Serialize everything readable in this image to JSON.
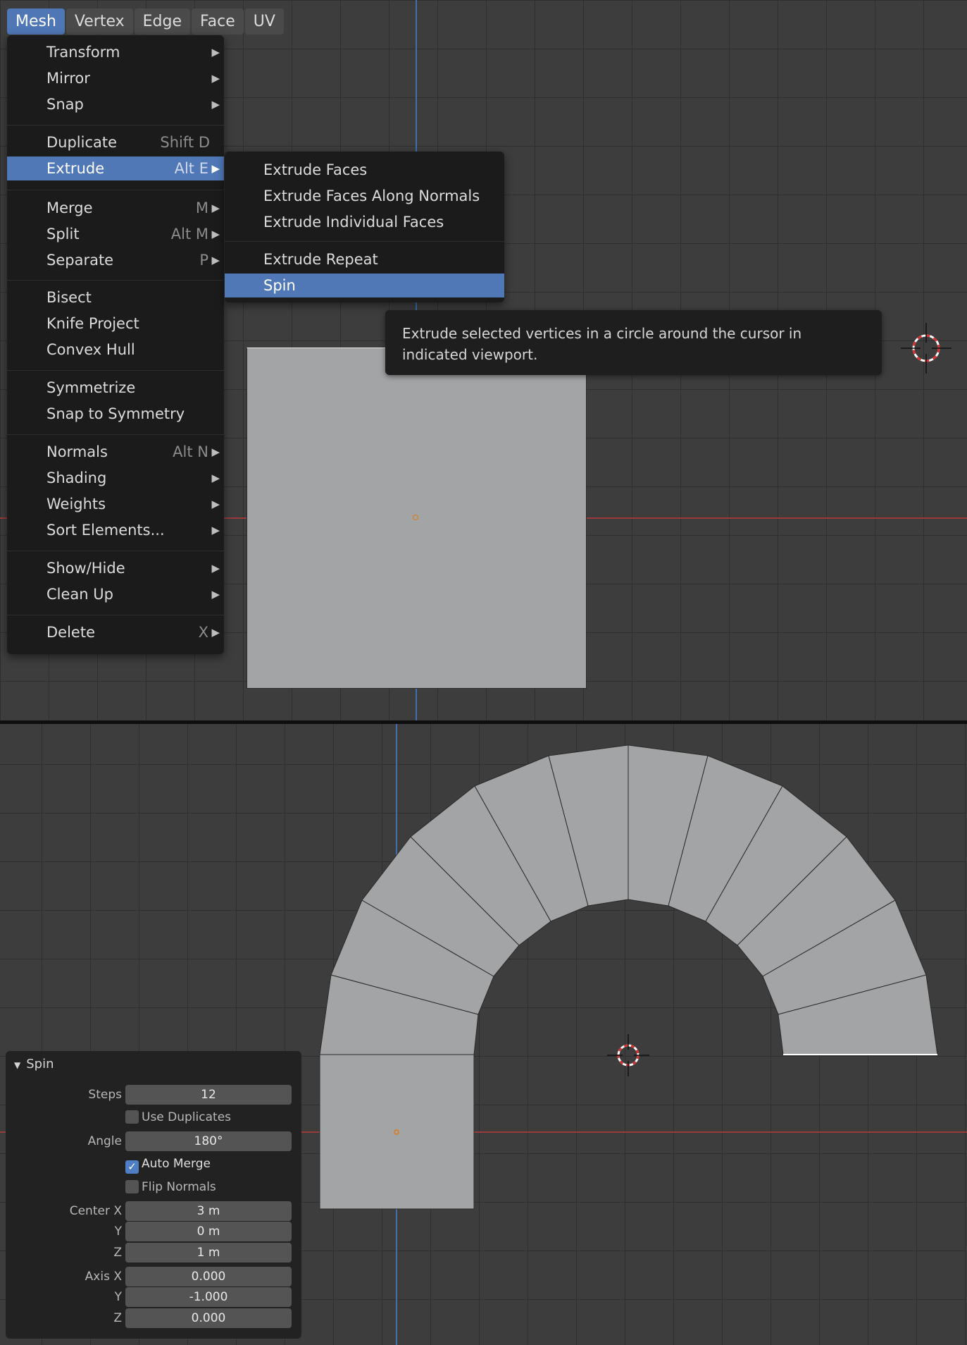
{
  "header_menus": [
    {
      "label": "Mesh",
      "active": true
    },
    {
      "label": "Vertex",
      "active": false
    },
    {
      "label": "Edge",
      "active": false
    },
    {
      "label": "Face",
      "active": false
    },
    {
      "label": "UV",
      "active": false
    }
  ],
  "mesh_menu": {
    "items": [
      {
        "label": "Transform",
        "shortcut": "",
        "submenu": true
      },
      {
        "label": "Mirror",
        "shortcut": "",
        "submenu": true
      },
      {
        "label": "Snap",
        "shortcut": "",
        "submenu": true
      },
      {
        "label": "Duplicate",
        "shortcut": "Shift D",
        "submenu": false
      },
      {
        "label": "Extrude",
        "shortcut": "Alt E",
        "submenu": true,
        "highlighted": true
      },
      {
        "label": "Merge",
        "shortcut": "M",
        "submenu": true
      },
      {
        "label": "Split",
        "shortcut": "Alt M",
        "submenu": true
      },
      {
        "label": "Separate",
        "shortcut": "P",
        "submenu": true
      },
      {
        "label": "Bisect",
        "shortcut": "",
        "submenu": false
      },
      {
        "label": "Knife Project",
        "shortcut": "",
        "submenu": false
      },
      {
        "label": "Convex Hull",
        "shortcut": "",
        "submenu": false
      },
      {
        "label": "Symmetrize",
        "shortcut": "",
        "submenu": false
      },
      {
        "label": "Snap to Symmetry",
        "shortcut": "",
        "submenu": false
      },
      {
        "label": "Normals",
        "shortcut": "Alt N",
        "submenu": true
      },
      {
        "label": "Shading",
        "shortcut": "",
        "submenu": true
      },
      {
        "label": "Weights",
        "shortcut": "",
        "submenu": true
      },
      {
        "label": "Sort Elements...",
        "shortcut": "",
        "submenu": true
      },
      {
        "label": "Show/Hide",
        "shortcut": "",
        "submenu": true
      },
      {
        "label": "Clean Up",
        "shortcut": "",
        "submenu": true
      },
      {
        "label": "Delete",
        "shortcut": "X",
        "submenu": true
      }
    ]
  },
  "extrude_menu": {
    "items": [
      {
        "label": "Extrude Faces"
      },
      {
        "label": "Extrude Faces Along Normals"
      },
      {
        "label": "Extrude Individual Faces"
      },
      {
        "label": "Extrude Repeat"
      },
      {
        "label": "Spin",
        "highlighted": true
      }
    ]
  },
  "tooltip": {
    "text": "Extrude selected vertices in a circle around the cursor in indicated viewport."
  },
  "spin_panel": {
    "title": "Spin",
    "steps_label": "Steps",
    "steps": "12",
    "use_duplicates_label": "Use Duplicates",
    "use_duplicates": false,
    "angle_label": "Angle",
    "angle": "180°",
    "auto_merge_label": "Auto Merge",
    "auto_merge": true,
    "flip_normals_label": "Flip Normals",
    "flip_normals": false,
    "center_x_label": "Center X",
    "center_x": "3 m",
    "center_y_label": "Y",
    "center_y": "0 m",
    "center_z_label": "Z",
    "center_z": "1 m",
    "axis_x_label": "Axis X",
    "axis_x": "0.000",
    "axis_y_label": "Y",
    "axis_y": "-1.000",
    "axis_z_label": "Z",
    "axis_z": "0.000"
  },
  "colors": {
    "accent": "#5078b7",
    "mesh_face": "#a3a4a6",
    "x_axis": "#9a3a3a",
    "z_axis": "#3f6fae"
  }
}
